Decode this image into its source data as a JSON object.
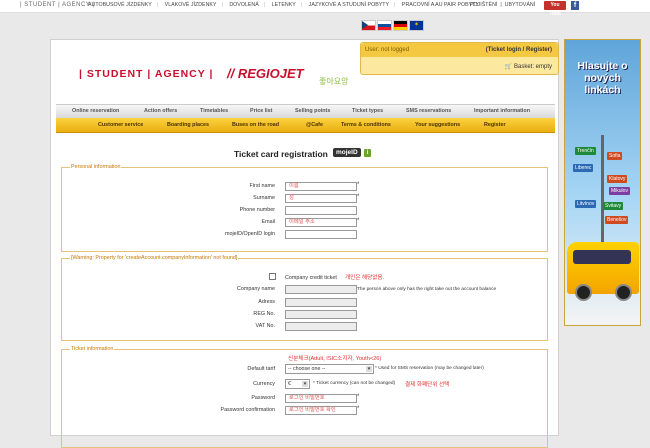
{
  "topbar": {
    "brand": "| STUDENT | AGENCY |",
    "nav": [
      "AUTOBUSOVÉ JÍZDENKY",
      "VLAKOVÉ JÍZDENKY",
      "DOVOLENÁ",
      "LETENKY",
      "JAZYKOVÉ A STUDIJNÍ POBYTY",
      "PRACOVNÍ A AU PAIR POBYTY"
    ],
    "right": [
      "POJIŠTĚNÍ",
      "UBYTOVÁNÍ"
    ],
    "youtube": "You Tube",
    "facebook": "f"
  },
  "flags": [
    {
      "name": "czech-flag",
      "colors": [
        "#ffffff",
        "#d7141a",
        "#11457e"
      ]
    },
    {
      "name": "slovak-flag",
      "colors": [
        "#ffffff",
        "#0b4ea2",
        "#ee1c25"
      ]
    },
    {
      "name": "german-flag",
      "colors": [
        "#000000",
        "#dd0000",
        "#ffce00"
      ]
    },
    {
      "name": "eu-flag",
      "colors": [
        "#003399",
        "#ffcc00"
      ]
    }
  ],
  "header": {
    "student_agency": "| STUDENT | AGENCY |",
    "regiojet": "// REGIOJET",
    "korean_logo": "좋아요앙"
  },
  "login": {
    "status": "User: not logged",
    "links": "(Ticket login / Register)",
    "basket": "Basket: empty"
  },
  "menu_main": [
    "Online reservation",
    "Action offers",
    "Timetables",
    "Price list",
    "Selling points",
    "Ticket types",
    "SMS reservations",
    "Important information"
  ],
  "menu_sub": [
    "Customer service",
    "Boarding places",
    "Buses on the road",
    "@Cafe",
    "Terms & conditions",
    "Your suggestions",
    "Register"
  ],
  "page": {
    "title": "Ticket card registration",
    "mojeid": "mojeID",
    "info": "i"
  },
  "personal": {
    "legend": "Personal information",
    "fields": [
      {
        "label": "First name",
        "value": "이름",
        "required": "*"
      },
      {
        "label": "Surname",
        "value": "성",
        "required": "*"
      },
      {
        "label": "Phone number",
        "value": "",
        "required": ""
      },
      {
        "label": "Email",
        "value": "이메일 주소",
        "required": "*"
      },
      {
        "label": "mojeID/OpenID login",
        "value": "",
        "required": ""
      }
    ]
  },
  "company": {
    "legend": "[Warning: Property for 'createAccount.companyInformation' not found]",
    "checkbox_label": "Company credit ticket",
    "checkbox_note": "개인은 해당없음.",
    "fields": [
      {
        "label": "Company name",
        "value": ""
      },
      {
        "label": "Adress",
        "value": ""
      },
      {
        "label": "REG No.",
        "value": ""
      },
      {
        "label": "VAT No.",
        "value": ""
      }
    ],
    "company_note": "The person above only has the right take out the account balance"
  },
  "ticket": {
    "legend": "Ticket information",
    "tariff_note_kr": "신분체크(Adult, ISIC소지자, Youth<26)",
    "tariff_label": "Default tarif",
    "tariff_value": "-- choose one --",
    "tariff_note": "Used for SMS reservation (may be changed later)",
    "currency_label": "Currency",
    "currency_value": "€",
    "currency_note": "Ticket currency (can not be changed)",
    "currency_note_kr": "결제 화폐단위 선택",
    "password_label": "Password",
    "password_value": "로그인 비밀번호",
    "confirm_label": "Password confirmation",
    "confirm_value": "로그인 비밀번호 확인",
    "required": "*"
  },
  "ad": {
    "headline": "Hlasujte o nových linkách",
    "signs": [
      "Trenčín",
      "Sofia",
      "Liberec",
      "Klatovy",
      "Mikulov",
      "Litvínov",
      "Svitavy",
      "Benešov"
    ]
  }
}
